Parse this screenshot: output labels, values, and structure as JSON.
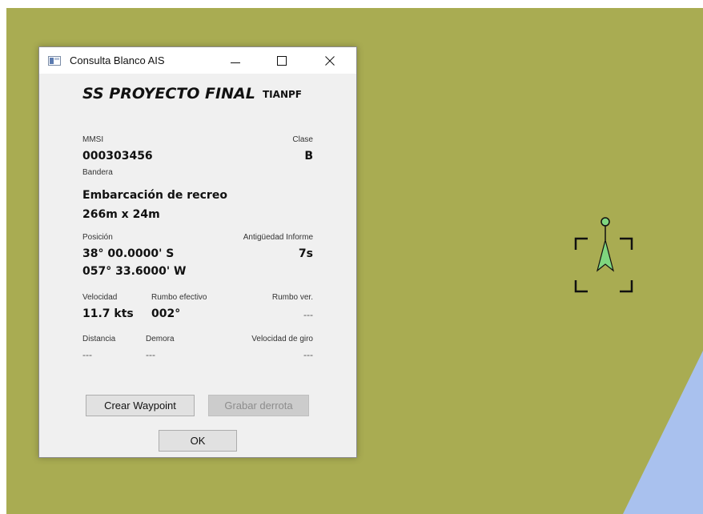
{
  "window": {
    "title": "Consulta Blanco AIS",
    "minimize_label": "—",
    "maximize_label": "☐",
    "close_label": "✕"
  },
  "vessel": {
    "name": "SS PROYECTO FINAL",
    "callsign": "TIANPF",
    "mmsi_label": "MMSI",
    "mmsi": "000303456",
    "class_label": "Clase",
    "class": "B",
    "flag_label": "Bandera",
    "type": "Embarcación de recreo",
    "dimensions": "266m x 24m",
    "position_label": "Posición",
    "latitude": "38° 00.0000' S",
    "longitude": "057° 33.6000' W",
    "report_age_label": "Antigüedad Informe",
    "report_age": "7s",
    "speed_label": "Velocidad",
    "speed": "11.7 kts",
    "course_label": "Rumbo efectivo",
    "course": "002°",
    "heading_label": "Rumbo ver.",
    "heading": "---",
    "distance_label": "Distancia",
    "distance": "---",
    "bearing_label": "Demora",
    "bearing": "---",
    "turn_rate_label": "Velocidad de giro",
    "turn_rate": "---"
  },
  "buttons": {
    "create_waypoint": "Crear Waypoint",
    "record_track": "Grabar derrota",
    "ok": "OK"
  },
  "colors": {
    "land": "#a9ac52",
    "water": "#a9c1ee",
    "target": "#7fd67f"
  }
}
